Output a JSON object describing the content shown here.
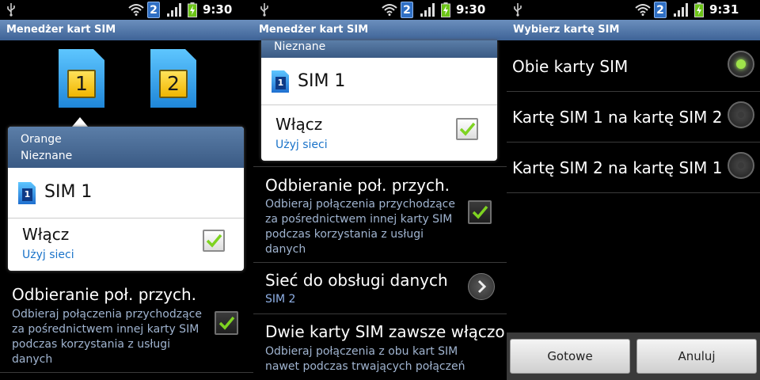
{
  "status_bar": {
    "sim_indicator": "2"
  },
  "screen1": {
    "title": "Menedżer kart SIM",
    "status_time": "9:30",
    "sim_cards": [
      "1",
      "2"
    ],
    "popup": {
      "operator": "Orange",
      "network": "Nieznane",
      "sim_badge": "1",
      "sim_name": "SIM 1",
      "enable_label": "Włącz",
      "enable_sub": "Użyj sieci",
      "enabled": true
    },
    "row": {
      "title": "Odbieranie poł. przych.",
      "sub": [
        "Odbieraj połączenia przychodzące",
        "za pośrednictwem innej karty SIM",
        "podczas korzystania z usługi",
        "danych"
      ],
      "checked": true
    }
  },
  "screen2": {
    "title": "Menedżer kart SIM",
    "status_time": "9:30",
    "popup": {
      "network": "Nieznane",
      "sim_badge": "1",
      "sim_name": "SIM 1",
      "enable_label": "Włącz",
      "enable_sub": "Użyj sieci",
      "enabled": true
    },
    "row_receive": {
      "title": "Odbieranie poł. przych.",
      "sub": [
        "Odbieraj połączenia przychodzące",
        "za pośrednictwem innej karty SIM",
        "podczas korzystania z usługi",
        "danych"
      ],
      "checked": true
    },
    "row_data": {
      "title": "Sieć do obsługi danych",
      "value": "SIM 2"
    },
    "row_dual": {
      "title": "Dwie karty SIM zawsze włączo",
      "sub": [
        "Odbieraj połączenia z obu kart SIM",
        "nawet podczas trwających połączeń"
      ]
    }
  },
  "screen3": {
    "title": "Wybierz kartę SIM",
    "status_time": "9:31",
    "options": [
      {
        "label": "Obie karty SIM",
        "selected": true
      },
      {
        "label": "Kartę SIM 1 na kartę SIM 2",
        "selected": false
      },
      {
        "label": "Kartę SIM 2 na kartę SIM 1",
        "selected": false
      }
    ],
    "ok_label": "Gotowe",
    "cancel_label": "Anuluj"
  },
  "colors": {
    "title_bar": "#4a6d9c",
    "accent_blue": "#1a73c9",
    "check_green": "#7ed321",
    "radio_on": "#9fe44a"
  }
}
